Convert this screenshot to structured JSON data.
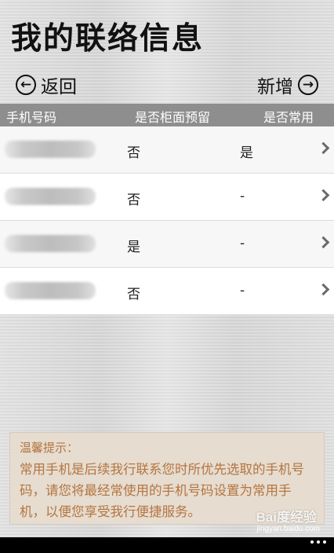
{
  "header": {
    "title": "我的联络信息",
    "back_label": "返回",
    "add_label": "新增"
  },
  "table": {
    "columns": [
      "手机号码",
      "是否柜面预留",
      "是否常用"
    ],
    "rows": [
      {
        "counter_reserved": "否",
        "common": "是"
      },
      {
        "counter_reserved": "否",
        "common": "-"
      },
      {
        "counter_reserved": "是",
        "common": "-"
      },
      {
        "counter_reserved": "否",
        "common": "-"
      }
    ]
  },
  "tip": {
    "title": "温馨提示：",
    "body": "常用手机是后续我行联系您时所优先选取的手机号码，请您将最经常使用的手机号码设置为常用手机，以便您享受我行便捷服务。"
  },
  "watermark": {
    "logo_text": "Bai度经验",
    "url": "jingyan.baidu.com"
  }
}
